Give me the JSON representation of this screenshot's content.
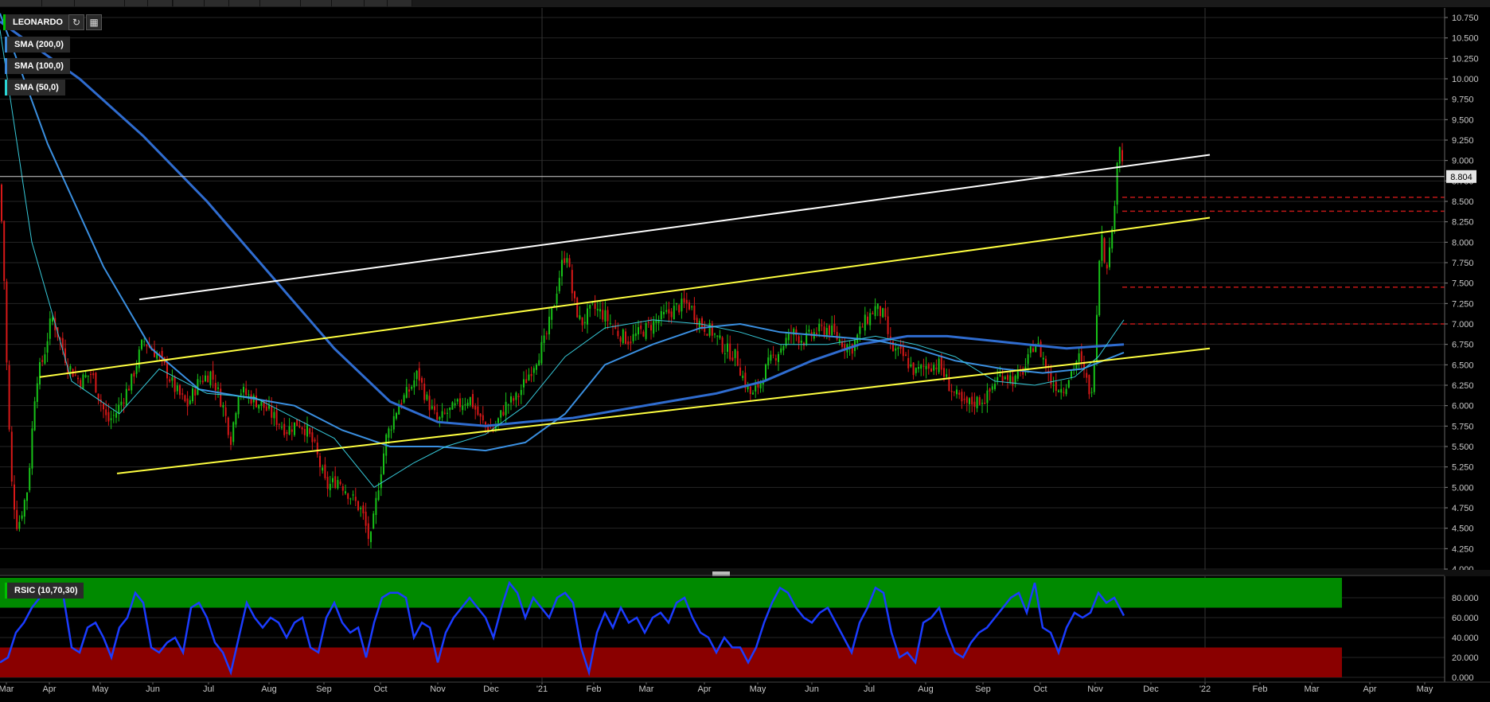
{
  "toolbar": {
    "title": "LEONARDO",
    "refresh_icon": "refresh-icon",
    "settings_icon": "calendar-icon"
  },
  "indicators": [
    {
      "label": "SMA (200,0)",
      "color": "#3a87d8"
    },
    {
      "label": "SMA (100,0)",
      "color": "#2a6fd0"
    },
    {
      "label": "SMA (50,0)",
      "color": "#2ad5d5"
    }
  ],
  "rsi_panel": {
    "label": "RSIC (10,70,30)"
  },
  "colors": {
    "up": "#18c218",
    "down": "#d81818",
    "sma200": "#2f6ccf",
    "sma100": "#3a8fe0",
    "sma50": "#36c8d8",
    "channel_yellow": "#ffff40",
    "trend_white": "#ffffff",
    "rsi_line": "#1b3cff",
    "rsi_overbought": "#008a00",
    "rsi_oversold": "#8a0000"
  },
  "chart_data": {
    "type": "candlestick",
    "title": "LEONARDO",
    "last_price": "8.804",
    "price_ticks": [
      "10.750",
      "10.500",
      "10.250",
      "10.000",
      "9.750",
      "9.500",
      "9.250",
      "9.000",
      "8.750",
      "8.500",
      "8.250",
      "8.000",
      "7.750",
      "7.500",
      "7.250",
      "7.000",
      "6.750",
      "6.500",
      "6.250",
      "6.000",
      "5.750",
      "5.500",
      "5.250",
      "5.000",
      "4.750",
      "4.500",
      "4.250",
      "4.000"
    ],
    "rsi_ticks": [
      "80.000",
      "60.000",
      "40.000",
      "20.000",
      "0.000"
    ],
    "x_ticks": [
      "Mar",
      "Apr",
      "May",
      "Jun",
      "Jul",
      "Aug",
      "Sep",
      "Oct",
      "Nov",
      "Dec",
      "'21",
      "Feb",
      "Mar",
      "Apr",
      "May",
      "Jun",
      "Jul",
      "Aug",
      "Sep",
      "Oct",
      "Nov",
      "Dec",
      "'22",
      "Feb",
      "Mar",
      "Apr",
      "May"
    ],
    "ylim": [
      4.0,
      10.75
    ],
    "rsi_ylim": [
      0,
      100
    ],
    "rsi_levels": [
      70,
      30
    ],
    "price_path": [
      [
        0,
        8.7
      ],
      [
        5,
        7.6
      ],
      [
        10,
        6.0
      ],
      [
        15,
        5.0
      ],
      [
        22,
        4.5
      ],
      [
        35,
        5.0
      ],
      [
        45,
        6.3
      ],
      [
        55,
        6.6
      ],
      [
        65,
        7.1
      ],
      [
        75,
        6.8
      ],
      [
        85,
        6.5
      ],
      [
        100,
        6.3
      ],
      [
        115,
        6.4
      ],
      [
        125,
        6.1
      ],
      [
        135,
        5.8
      ],
      [
        145,
        5.9
      ],
      [
        165,
        6.3
      ],
      [
        180,
        6.8
      ],
      [
        200,
        6.6
      ],
      [
        210,
        6.4
      ],
      [
        220,
        6.2
      ],
      [
        235,
        6.0
      ],
      [
        250,
        6.3
      ],
      [
        265,
        6.4
      ],
      [
        280,
        6.0
      ],
      [
        290,
        5.6
      ],
      [
        300,
        6.2
      ],
      [
        315,
        6.1
      ],
      [
        330,
        6.0
      ],
      [
        340,
        5.9
      ],
      [
        360,
        5.7
      ],
      [
        375,
        5.8
      ],
      [
        385,
        5.7
      ],
      [
        395,
        5.5
      ],
      [
        410,
        5.0
      ],
      [
        425,
        5.1
      ],
      [
        440,
        4.9
      ],
      [
        455,
        4.7
      ],
      [
        465,
        4.3
      ],
      [
        475,
        5.0
      ],
      [
        485,
        5.6
      ],
      [
        500,
        6.0
      ],
      [
        515,
        6.2
      ],
      [
        525,
        6.4
      ],
      [
        535,
        6.1
      ],
      [
        550,
        5.8
      ],
      [
        560,
        5.9
      ],
      [
        575,
        6.0
      ],
      [
        590,
        6.1
      ],
      [
        605,
        5.8
      ],
      [
        620,
        5.7
      ],
      [
        635,
        6.0
      ],
      [
        650,
        6.1
      ],
      [
        665,
        6.4
      ],
      [
        675,
        6.6
      ],
      [
        685,
        6.8
      ],
      [
        695,
        7.2
      ],
      [
        705,
        7.7
      ],
      [
        712,
        7.9
      ],
      [
        720,
        7.3
      ],
      [
        730,
        7.0
      ],
      [
        745,
        7.2
      ],
      [
        760,
        7.1
      ],
      [
        775,
        6.9
      ],
      [
        790,
        6.8
      ],
      [
        805,
        6.9
      ],
      [
        820,
        7.0
      ],
      [
        835,
        7.1
      ],
      [
        850,
        7.2
      ],
      [
        865,
        7.25
      ],
      [
        880,
        7.0
      ],
      [
        895,
        6.9
      ],
      [
        910,
        6.7
      ],
      [
        925,
        6.6
      ],
      [
        935,
        6.3
      ],
      [
        945,
        6.1
      ],
      [
        955,
        6.3
      ],
      [
        965,
        6.5
      ],
      [
        980,
        6.7
      ],
      [
        995,
        6.9
      ],
      [
        1010,
        6.8
      ],
      [
        1025,
        6.9
      ],
      [
        1040,
        6.95
      ],
      [
        1055,
        6.8
      ],
      [
        1070,
        6.7
      ],
      [
        1085,
        7.0
      ],
      [
        1100,
        7.2
      ],
      [
        1110,
        7.1
      ],
      [
        1120,
        6.7
      ],
      [
        1135,
        6.6
      ],
      [
        1150,
        6.4
      ],
      [
        1165,
        6.5
      ],
      [
        1180,
        6.5
      ],
      [
        1195,
        6.2
      ],
      [
        1210,
        6.0
      ],
      [
        1225,
        6.05
      ],
      [
        1240,
        6.1
      ],
      [
        1250,
        6.3
      ],
      [
        1262,
        6.4
      ],
      [
        1275,
        6.3
      ],
      [
        1290,
        6.5
      ],
      [
        1300,
        6.8
      ],
      [
        1310,
        6.6
      ],
      [
        1320,
        6.3
      ],
      [
        1335,
        6.2
      ],
      [
        1345,
        6.4
      ],
      [
        1355,
        6.6
      ],
      [
        1365,
        6.3
      ],
      [
        1372,
        6.1
      ],
      [
        1377,
        7.0
      ],
      [
        1381,
        7.8
      ],
      [
        1385,
        8.2
      ],
      [
        1390,
        7.5
      ],
      [
        1393,
        8.0
      ],
      [
        1398,
        8.1
      ],
      [
        1403,
        9.0
      ],
      [
        1407,
        9.2
      ],
      [
        1412,
        8.8
      ]
    ],
    "sma50_path": [
      [
        0,
        10.6
      ],
      [
        40,
        8.0
      ],
      [
        90,
        6.3
      ],
      [
        150,
        5.9
      ],
      [
        200,
        6.45
      ],
      [
        260,
        6.15
      ],
      [
        320,
        6.1
      ],
      [
        380,
        5.8
      ],
      [
        420,
        5.6
      ],
      [
        470,
        5.0
      ],
      [
        520,
        5.3
      ],
      [
        560,
        5.5
      ],
      [
        610,
        5.65
      ],
      [
        660,
        6.0
      ],
      [
        710,
        6.6
      ],
      [
        760,
        6.95
      ],
      [
        820,
        7.05
      ],
      [
        880,
        7.0
      ],
      [
        930,
        6.9
      ],
      [
        980,
        6.75
      ],
      [
        1040,
        6.75
      ],
      [
        1100,
        6.85
      ],
      [
        1150,
        6.75
      ],
      [
        1200,
        6.6
      ],
      [
        1250,
        6.3
      ],
      [
        1300,
        6.25
      ],
      [
        1350,
        6.35
      ],
      [
        1380,
        6.6
      ],
      [
        1412,
        7.05
      ]
    ],
    "sma100_path": [
      [
        0,
        10.8
      ],
      [
        60,
        9.2
      ],
      [
        130,
        7.7
      ],
      [
        190,
        6.7
      ],
      [
        250,
        6.2
      ],
      [
        310,
        6.1
      ],
      [
        370,
        6.0
      ],
      [
        430,
        5.7
      ],
      [
        490,
        5.5
      ],
      [
        550,
        5.5
      ],
      [
        610,
        5.45
      ],
      [
        660,
        5.55
      ],
      [
        710,
        5.9
      ],
      [
        760,
        6.5
      ],
      [
        820,
        6.75
      ],
      [
        880,
        6.95
      ],
      [
        930,
        7.0
      ],
      [
        980,
        6.9
      ],
      [
        1040,
        6.85
      ],
      [
        1100,
        6.8
      ],
      [
        1150,
        6.7
      ],
      [
        1200,
        6.55
      ],
      [
        1260,
        6.45
      ],
      [
        1310,
        6.4
      ],
      [
        1360,
        6.45
      ],
      [
        1412,
        6.65
      ]
    ],
    "sma200_path": [
      [
        0,
        10.7
      ],
      [
        100,
        10.0
      ],
      [
        180,
        9.3
      ],
      [
        260,
        8.5
      ],
      [
        340,
        7.6
      ],
      [
        420,
        6.7
      ],
      [
        490,
        6.05
      ],
      [
        550,
        5.8
      ],
      [
        610,
        5.75
      ],
      [
        660,
        5.8
      ],
      [
        720,
        5.85
      ],
      [
        780,
        5.95
      ],
      [
        840,
        6.05
      ],
      [
        900,
        6.15
      ],
      [
        960,
        6.3
      ],
      [
        1020,
        6.55
      ],
      [
        1080,
        6.75
      ],
      [
        1140,
        6.85
      ],
      [
        1190,
        6.85
      ],
      [
        1240,
        6.8
      ],
      [
        1290,
        6.75
      ],
      [
        1340,
        6.7
      ],
      [
        1412,
        6.75
      ]
    ],
    "rsi_path": [
      [
        0,
        15
      ],
      [
        10,
        20
      ],
      [
        20,
        45
      ],
      [
        30,
        55
      ],
      [
        40,
        70
      ],
      [
        50,
        80
      ],
      [
        60,
        85
      ],
      [
        70,
        90
      ],
      [
        80,
        80
      ],
      [
        90,
        30
      ],
      [
        100,
        25
      ],
      [
        110,
        50
      ],
      [
        120,
        55
      ],
      [
        130,
        40
      ],
      [
        140,
        20
      ],
      [
        150,
        50
      ],
      [
        160,
        60
      ],
      [
        170,
        85
      ],
      [
        180,
        75
      ],
      [
        190,
        30
      ],
      [
        200,
        25
      ],
      [
        210,
        35
      ],
      [
        220,
        40
      ],
      [
        230,
        25
      ],
      [
        240,
        70
      ],
      [
        250,
        75
      ],
      [
        260,
        60
      ],
      [
        270,
        35
      ],
      [
        280,
        25
      ],
      [
        290,
        5
      ],
      [
        300,
        40
      ],
      [
        310,
        75
      ],
      [
        320,
        60
      ],
      [
        330,
        50
      ],
      [
        340,
        60
      ],
      [
        350,
        55
      ],
      [
        360,
        40
      ],
      [
        370,
        55
      ],
      [
        380,
        60
      ],
      [
        390,
        30
      ],
      [
        400,
        25
      ],
      [
        410,
        60
      ],
      [
        420,
        75
      ],
      [
        430,
        55
      ],
      [
        440,
        45
      ],
      [
        450,
        50
      ],
      [
        460,
        20
      ],
      [
        470,
        55
      ],
      [
        480,
        80
      ],
      [
        490,
        85
      ],
      [
        500,
        85
      ],
      [
        510,
        80
      ],
      [
        520,
        40
      ],
      [
        530,
        55
      ],
      [
        540,
        50
      ],
      [
        550,
        15
      ],
      [
        560,
        45
      ],
      [
        570,
        60
      ],
      [
        580,
        70
      ],
      [
        590,
        80
      ],
      [
        600,
        70
      ],
      [
        610,
        60
      ],
      [
        620,
        40
      ],
      [
        630,
        70
      ],
      [
        640,
        95
      ],
      [
        650,
        85
      ],
      [
        660,
        60
      ],
      [
        670,
        80
      ],
      [
        680,
        70
      ],
      [
        690,
        60
      ],
      [
        700,
        80
      ],
      [
        710,
        85
      ],
      [
        720,
        75
      ],
      [
        730,
        30
      ],
      [
        740,
        5
      ],
      [
        750,
        45
      ],
      [
        760,
        65
      ],
      [
        770,
        50
      ],
      [
        780,
        70
      ],
      [
        790,
        55
      ],
      [
        800,
        60
      ],
      [
        810,
        45
      ],
      [
        820,
        60
      ],
      [
        830,
        65
      ],
      [
        840,
        55
      ],
      [
        850,
        75
      ],
      [
        860,
        80
      ],
      [
        870,
        60
      ],
      [
        880,
        45
      ],
      [
        890,
        40
      ],
      [
        900,
        25
      ],
      [
        910,
        40
      ],
      [
        920,
        30
      ],
      [
        930,
        30
      ],
      [
        940,
        15
      ],
      [
        950,
        30
      ],
      [
        960,
        55
      ],
      [
        970,
        75
      ],
      [
        980,
        90
      ],
      [
        990,
        85
      ],
      [
        1000,
        70
      ],
      [
        1010,
        60
      ],
      [
        1020,
        55
      ],
      [
        1030,
        65
      ],
      [
        1040,
        70
      ],
      [
        1050,
        55
      ],
      [
        1060,
        40
      ],
      [
        1070,
        25
      ],
      [
        1080,
        55
      ],
      [
        1090,
        70
      ],
      [
        1100,
        90
      ],
      [
        1110,
        85
      ],
      [
        1120,
        45
      ],
      [
        1130,
        20
      ],
      [
        1140,
        25
      ],
      [
        1150,
        15
      ],
      [
        1160,
        55
      ],
      [
        1170,
        60
      ],
      [
        1180,
        70
      ],
      [
        1190,
        45
      ],
      [
        1200,
        25
      ],
      [
        1210,
        20
      ],
      [
        1220,
        35
      ],
      [
        1230,
        45
      ],
      [
        1240,
        50
      ],
      [
        1250,
        60
      ],
      [
        1260,
        70
      ],
      [
        1270,
        80
      ],
      [
        1280,
        85
      ],
      [
        1290,
        65
      ],
      [
        1300,
        95
      ],
      [
        1310,
        50
      ],
      [
        1320,
        45
      ],
      [
        1330,
        25
      ],
      [
        1340,
        50
      ],
      [
        1350,
        65
      ],
      [
        1360,
        60
      ],
      [
        1370,
        65
      ],
      [
        1380,
        85
      ],
      [
        1390,
        75
      ],
      [
        1400,
        80
      ],
      [
        1412,
        62
      ]
    ],
    "channel_upper": [
      [
        50,
        6.35
      ],
      [
        1520,
        8.3
      ]
    ],
    "channel_lower": [
      [
        147,
        5.17
      ],
      [
        1520,
        6.7
      ]
    ],
    "white_trend": [
      [
        175,
        7.3
      ],
      [
        1520,
        9.07
      ]
    ],
    "resistance_levels": [
      8.55,
      8.38,
      7.45,
      7.0
    ],
    "current_price_line": 8.804
  }
}
